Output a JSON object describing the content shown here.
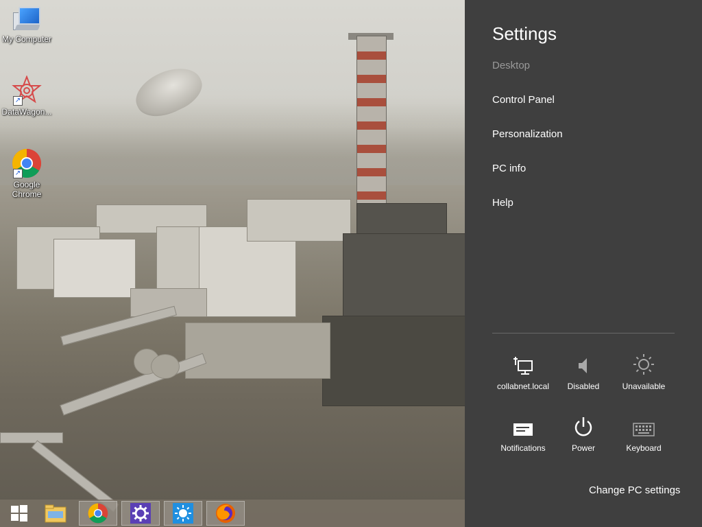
{
  "desktop": {
    "icons": [
      {
        "label": "My Computer"
      },
      {
        "label": "DataWagon..."
      },
      {
        "label": "Google Chrome"
      }
    ]
  },
  "taskbar": {
    "items": [
      {
        "icon": "windows-start-icon"
      },
      {
        "icon": "file-explorer-icon"
      },
      {
        "icon": "chrome-icon",
        "active": true
      },
      {
        "icon": "settings-gear-icon"
      },
      {
        "icon": "weather-sun-icon"
      },
      {
        "icon": "firefox-icon"
      }
    ]
  },
  "charm": {
    "title": "Settings",
    "items": [
      {
        "label": "Desktop",
        "enabled": false
      },
      {
        "label": "Control Panel",
        "enabled": true
      },
      {
        "label": "Personalization",
        "enabled": true
      },
      {
        "label": "PC info",
        "enabled": true
      },
      {
        "label": "Help",
        "enabled": true
      }
    ],
    "quick": [
      {
        "label": "collabnet.local",
        "icon": "network-icon"
      },
      {
        "label": "Disabled",
        "icon": "volume-icon"
      },
      {
        "label": "Unavailable",
        "icon": "brightness-icon"
      },
      {
        "label": "Notifications",
        "icon": "notifications-icon"
      },
      {
        "label": "Power",
        "icon": "power-icon"
      },
      {
        "label": "Keyboard",
        "icon": "keyboard-icon"
      }
    ],
    "change_pc_settings": "Change PC settings"
  },
  "colors": {
    "charm_bg": "#3f3f3f",
    "taskbar_bg": "#786f63",
    "disabled_text": "#9a9a9a"
  }
}
